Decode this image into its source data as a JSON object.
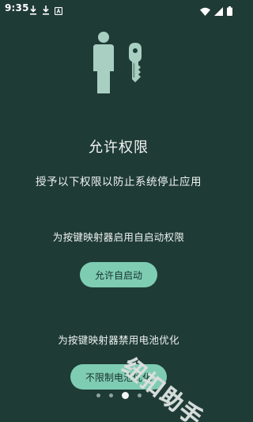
{
  "status_bar": {
    "time": "9:35",
    "icons": [
      "download-icon",
      "download-icon",
      "app-notification-icon",
      "wifi-icon",
      "cellular-signal-icon",
      "battery-icon"
    ]
  },
  "hero": {
    "icon": "person-with-key-icon"
  },
  "title": "允许权限",
  "subtitle": "授予以下权限以防止系统停止应用",
  "sections": [
    {
      "text": "为按键映射器启用自启动权限",
      "button_label": "允许自启动"
    },
    {
      "text": "为按键映射器禁用电池优化",
      "button_label": "不限制电池优化"
    }
  ],
  "pager": {
    "total": 4,
    "active_index": 2
  },
  "watermark": "纽扣助手",
  "colors": {
    "background": "#1f3b35",
    "accent": "#7ecdb3",
    "icon": "#a9cfc2",
    "text": "#eef3f1"
  }
}
